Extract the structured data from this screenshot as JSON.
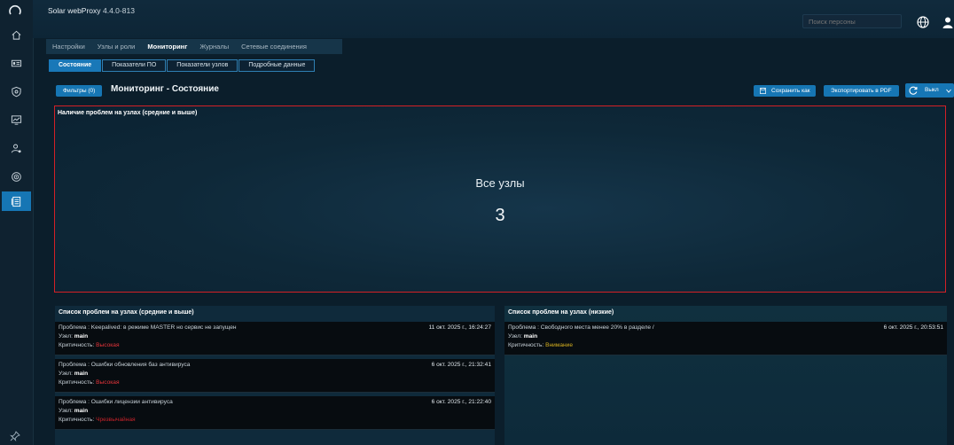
{
  "app": {
    "name": "Solar webProxy",
    "version": "4.4.0-813"
  },
  "search": {
    "placeholder": "Поиск персоны"
  },
  "main_tabs": [
    {
      "label": "Настройки"
    },
    {
      "label": "Узлы и роли"
    },
    {
      "label": "Мониторинг"
    },
    {
      "label": "Журналы"
    },
    {
      "label": "Сетевые соединения"
    }
  ],
  "sub_tabs": [
    {
      "label": "Состояние"
    },
    {
      "label": "Показатели ПО"
    },
    {
      "label": "Показатели узлов"
    },
    {
      "label": "Подробные данные"
    }
  ],
  "toolbar": {
    "filters_label": "Фильтры (0)",
    "page_title": "Мониторинг - Состояние",
    "save_label": "Сохранить как",
    "export_label": "Экспортировать в PDF",
    "refresh_label": "Выкл"
  },
  "alert_panel": {
    "title": "Наличие проблем на узлах (средние и выше)",
    "all_nodes_label": "Все узлы",
    "all_nodes_value": "3"
  },
  "left_list": {
    "title": "Список проблем на узлах (средние и выше)",
    "items": [
      {
        "problem": "Проблема : Keepalived: в режиме MASTER но сервис не запущен",
        "node_prefix": "Узел:",
        "node": "main",
        "crit_prefix": "Критичность:",
        "crit": "Высокая",
        "date": "11 окт. 2025 г., 16:24:27"
      },
      {
        "problem": "Проблема : Ошибки обновления баз антивируса",
        "node_prefix": "Узел:",
        "node": "main",
        "crit_prefix": "Критичность:",
        "crit": "Высокая",
        "date": "6 окт. 2025 г., 21:32:41"
      },
      {
        "problem": "Проблема : Ошибки лицензии антивируса",
        "node_prefix": "Узел:",
        "node": "main",
        "crit_prefix": "Критичность:",
        "crit": "Чрезвычайная",
        "date": "6 окт. 2025 г., 21:22:40"
      }
    ]
  },
  "right_list": {
    "title": "Список проблем на узлах (низкие)",
    "items": [
      {
        "problem": "Проблема : Свободного места менее 20% в разделе /",
        "node_prefix": "Узел:",
        "node": "main",
        "crit_prefix": "Критичность:",
        "crit": "Внимание",
        "date": "6 окт. 2025 г., 20:53:51"
      }
    ]
  },
  "colors": {
    "accent": "#1676b4",
    "alert_border": "#d32026",
    "critical": "#e5343a",
    "attention": "#d6b01f"
  },
  "icons": [
    "logo-icon",
    "home-icon",
    "id-card-icon",
    "shield-icon",
    "monitor-chart-icon",
    "user-settings-icon",
    "network-globe-icon",
    "journal-icon",
    "pin-icon",
    "globe-icon",
    "user-icon",
    "save-icon",
    "refresh-icon",
    "chevron-down-icon"
  ]
}
